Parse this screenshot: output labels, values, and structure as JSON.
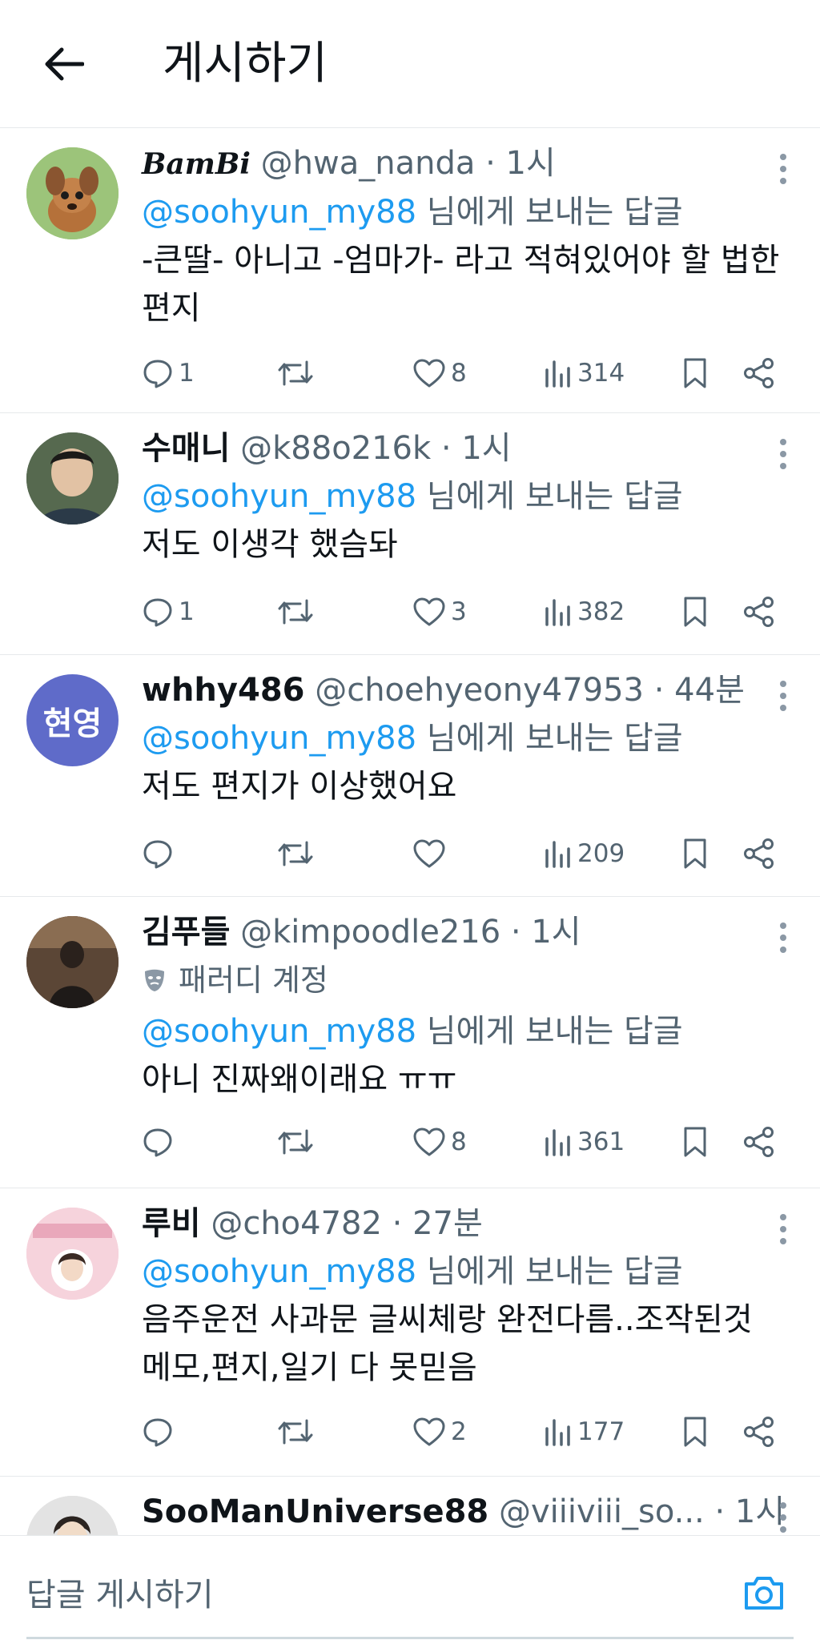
{
  "header": {
    "title": "게시하기"
  },
  "posts": [
    {
      "name": "BamBi",
      "handle": "@hwa_nanda",
      "time": "1시",
      "reply_to": "@soohyun_my88",
      "reply_suffix": " 님에게 보내는 답글",
      "text": "-큰딸- 아니고 -엄마가- 라고 적혀있어야 할 법한 편지",
      "replies": "1",
      "likes": "8",
      "views": "314",
      "avatar_color": "#7aa35a"
    },
    {
      "name": "수매니",
      "handle": "@k88o216k",
      "time": "1시",
      "reply_to": "@soohyun_my88",
      "reply_suffix": " 님에게 보내는 답글",
      "text": "저도 이생각 했슴돠",
      "replies": "1",
      "likes": "3",
      "views": "382",
      "avatar_color": "#3b4a3e"
    },
    {
      "name": "whhy486",
      "handle": "@choehyeony47953",
      "time": "44분",
      "reply_to": "@soohyun_my88",
      "reply_suffix": " 님에게 보내는 답글",
      "text": "저도 편지가 이상했어요",
      "replies": "",
      "likes": "",
      "views": "209",
      "avatar_text": "현영",
      "avatar_color": "#5f6bc9"
    },
    {
      "name": "김푸들",
      "handle": "@kimpoodle216",
      "time": "1시",
      "parody": "패러디 계정",
      "reply_to": "@soohyun_my88",
      "reply_suffix": " 님에게 보내는 답글",
      "text": "아니 진짜왜이래요 ㅠㅠ",
      "replies": "",
      "likes": "8",
      "views": "361",
      "avatar_color": "#4a3b32"
    },
    {
      "name": "루비",
      "handle": "@cho4782",
      "time": "27분",
      "reply_to": "@soohyun_my88",
      "reply_suffix": " 님에게 보내는 답글",
      "text": "음주운전 사과문 글씨체랑 완전다름..조작된것 메모,편지,일기 다 못믿음",
      "replies": "",
      "likes": "2",
      "views": "177",
      "avatar_color": "#f1c6d3"
    },
    {
      "name": "SooManUniverse88",
      "handle": "@viiiviii_so...",
      "time": "1시",
      "avatar_color": "#d8d8d8"
    }
  ],
  "composer": {
    "placeholder": "답글 게시하기"
  },
  "colors": {
    "accent": "#1d9bf0",
    "text": "#0f1419",
    "secondary": "#536471",
    "divider": "#e6e9eb"
  },
  "icons": [
    "back-arrow-icon",
    "more-icon",
    "reply-icon",
    "retweet-icon",
    "like-icon",
    "views-icon",
    "bookmark-icon",
    "share-icon",
    "parody-mask-icon",
    "camera-icon"
  ]
}
